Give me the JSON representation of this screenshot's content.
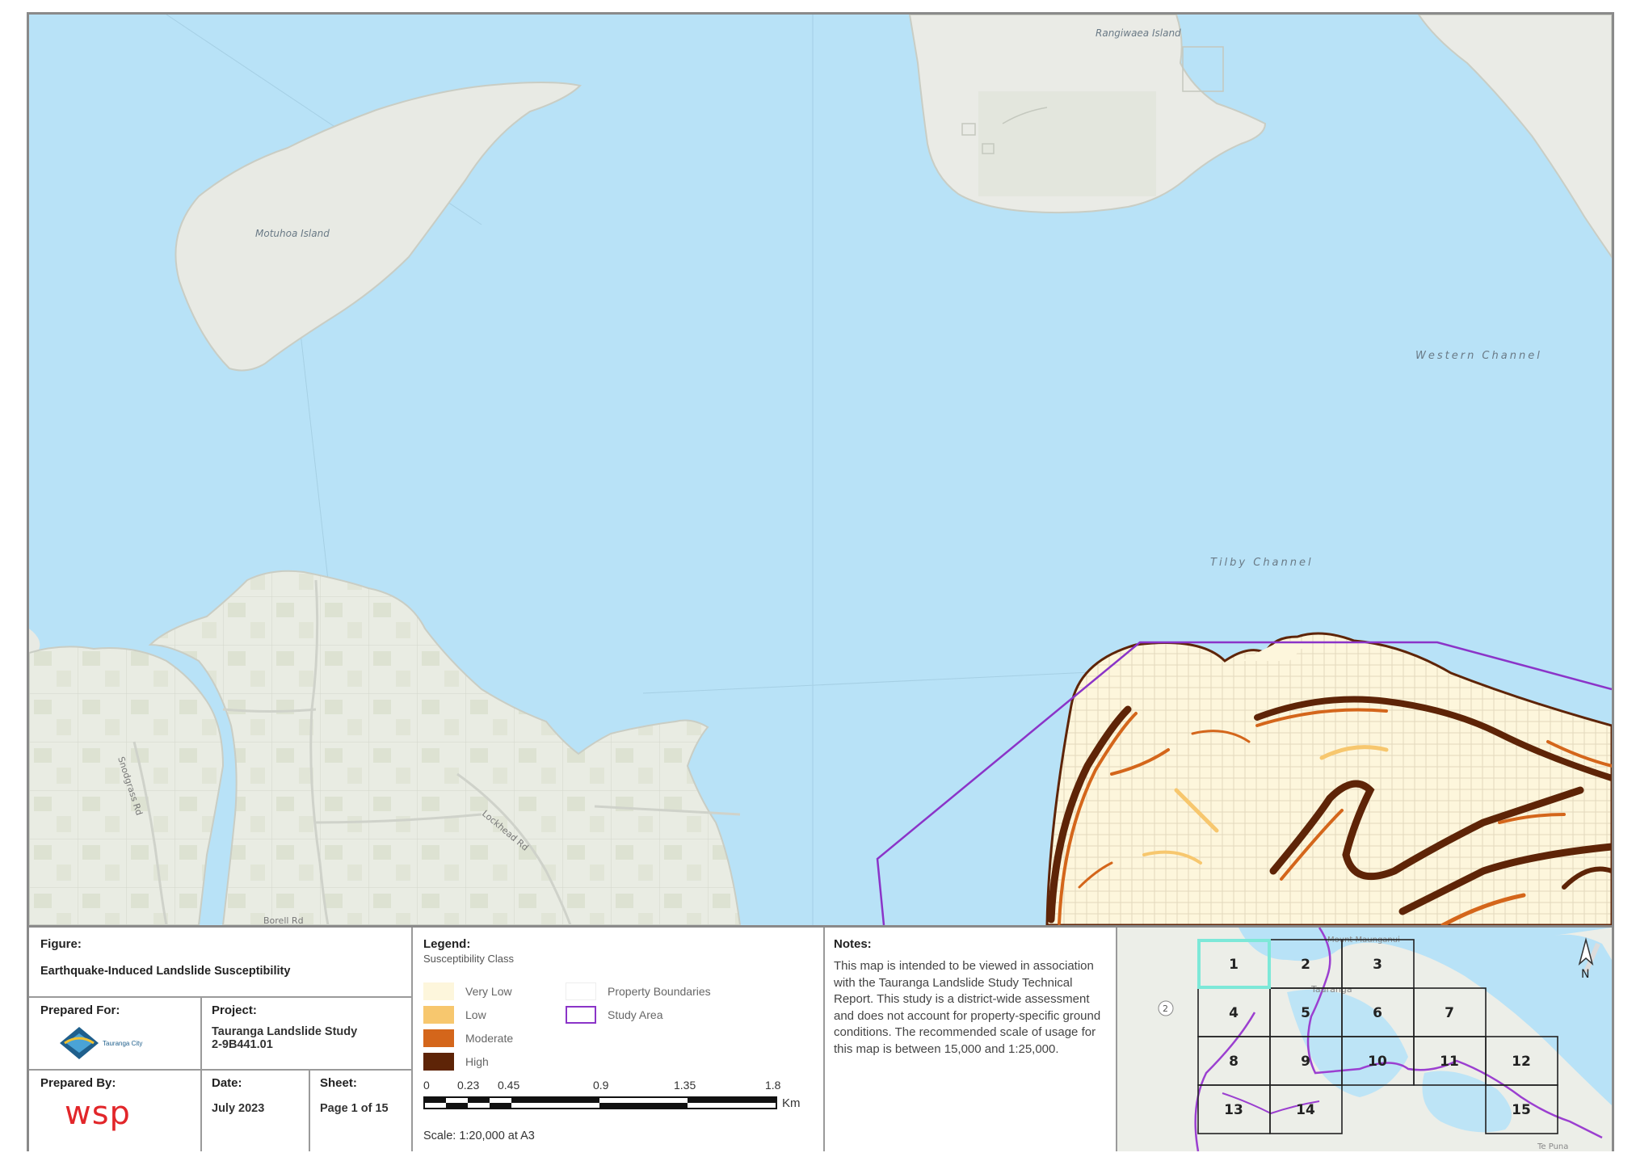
{
  "map": {
    "labels": {
      "motuhoa": "Motuhoa Island",
      "rangiwaea": "Rangiwaea Island",
      "western_channel": "Western Channel",
      "tilby_channel": "Tilby Channel",
      "road_1": "Snodgrass Rd",
      "road_2": "Lockhead Rd",
      "road_3": "Borell Rd"
    },
    "colors": {
      "water": "#b8e2f7",
      "land": "#eceee8",
      "farmland": "#dfe3d6",
      "very_low": "#fdf6dc",
      "low": "#f7c76e",
      "moderate": "#d4661b",
      "high": "#5e2407",
      "study_area": "#8b34c8"
    }
  },
  "figure": {
    "heading": "Figure:",
    "title": "Earthquake-Induced Landslide Susceptibility"
  },
  "prepared_for": {
    "heading": "Prepared For:",
    "logo_text": "Tauranga City"
  },
  "project": {
    "heading": "Project:",
    "name": "Tauranga Landslide Study",
    "number": "2-9B441.01"
  },
  "prepared_by": {
    "heading": "Prepared By:",
    "logo_text": "wsp"
  },
  "date": {
    "heading": "Date:",
    "value": "July 2023"
  },
  "sheet": {
    "heading": "Sheet:",
    "value": "Page 1 of 15"
  },
  "legend": {
    "heading": "Legend:",
    "subheading": "Susceptibility Class",
    "classes": [
      {
        "label": "Very Low",
        "color": "#fdf6dc"
      },
      {
        "label": "Low",
        "color": "#f7c76e"
      },
      {
        "label": "Moderate",
        "color": "#d4661b"
      },
      {
        "label": "High",
        "color": "#5e2407"
      }
    ],
    "property_boundaries": "Property Boundaries",
    "study_area": "Study Area"
  },
  "scale_bar": {
    "ticks": [
      "0",
      "0.23",
      "0.45",
      "0.9",
      "1.35",
      "1.8"
    ],
    "unit": "Km",
    "text": "Scale: 1:20,000 at A3"
  },
  "notes": {
    "heading": "Notes:",
    "text": "This map is intended to be viewed in association with the Tauranga Landslide Study Technical Report. This study is a district-wide assessment and does not account for property-specific ground conditions. The recommended scale of usage for this map is between 15,000 and 1:25,000."
  },
  "index_map": {
    "north": "N",
    "highway": "2",
    "place_1": "Tauranga",
    "place_2": "Te Puna",
    "place_3": "Mount Maunganui",
    "sheets": [
      "1",
      "2",
      "3",
      "4",
      "5",
      "6",
      "7",
      "8",
      "9",
      "10",
      "11",
      "12",
      "13",
      "14",
      "15"
    ],
    "current_sheet": "1"
  }
}
